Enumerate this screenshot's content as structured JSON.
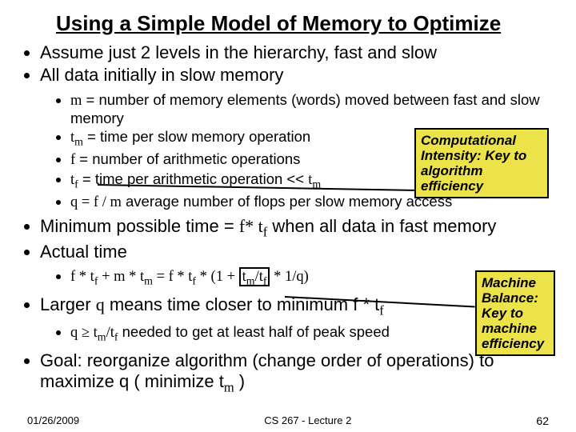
{
  "title": "Using a Simple Model of Memory to Optimize",
  "bullets1a": {
    "b1": "Assume just 2 levels in the hierarchy, fast and slow",
    "b2": "All data initially in slow memory"
  },
  "bullets2a": {
    "b1_pre": "m",
    "b1_post": " = number of memory elements (words) moved between fast and slow memory",
    "b2_pre": "t",
    "b2_sub": "m",
    "b2_post": " = time per slow memory operation",
    "b3_pre": "f",
    "b3_post": " = number of arithmetic operations",
    "b4_pre": "t",
    "b4_sub": "f",
    "b4_post": " = time per arithmetic operation << ",
    "b4_tail": "t",
    "b4_tailsub": "m",
    "b5_pre": "q = f / m",
    "b5_post": "  average number of flops per slow memory access"
  },
  "bullets1b": {
    "b1_pre": "Minimum possible time = ",
    "b1_mid": "f* t",
    "b1_sub": "f",
    "b1_post": " when all data in fast memory",
    "b2": "Actual time"
  },
  "bullets2b": {
    "eq_a": "f * t",
    "eq_asub": "f",
    "eq_b": " + m * t",
    "eq_bsub": "m",
    "eq_c": " = f * t",
    "eq_csub": "f",
    "eq_d": " * (1 + ",
    "eq_hi_a": "t",
    "eq_hi_asub": "m",
    "eq_hi_b": "/t",
    "eq_hi_bsub": "f",
    "eq_e": " * 1/q)"
  },
  "bullets1c": {
    "b1_pre": "Larger ",
    "b1_q": "q",
    "b1_mid": " means time closer to minimum f * t",
    "b1_sub": "f"
  },
  "bullets2c": {
    "b1_a": "q ",
    "b1_ge": "≥",
    "b1_b": " t",
    "b1_bsub": "m",
    "b1_c": "/t",
    "b1_csub": "f",
    "b1_d": "  needed to get at least half of peak speed"
  },
  "bullets1d": {
    "b1_pre": "Goal: reorganize algorithm (change order of operations) to maximize q ( minimize t",
    "b1_sub": "m",
    "b1_post": " )"
  },
  "callout1": {
    "lead": "Computational Intensity:",
    "rest": " Key to algorithm efficiency"
  },
  "callout2": {
    "lead": "Machine Balance:",
    "rest": " Key to machine efficiency"
  },
  "footer": {
    "date": "01/26/2009",
    "course": "CS 267 - Lecture 2",
    "page": "62"
  }
}
